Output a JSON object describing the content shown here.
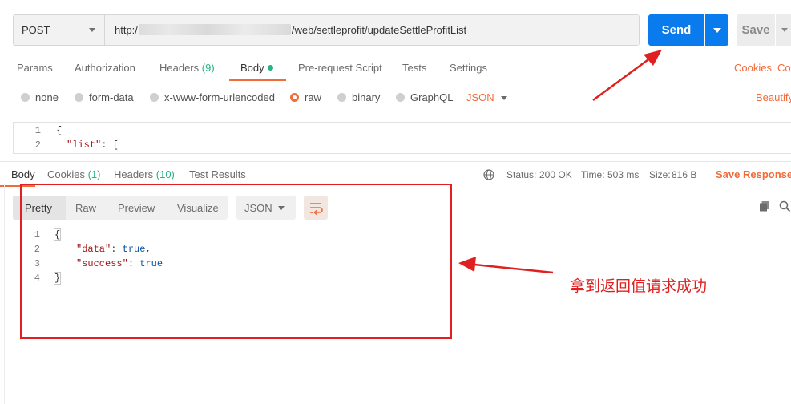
{
  "request": {
    "method": "POST",
    "url_prefix": "http:/",
    "url_suffix": "/web/settleprofit/updateSettleProfitList",
    "send_label": "Send",
    "save_label": "Save"
  },
  "request_tabs": {
    "params": "Params",
    "authorization": "Authorization",
    "headers": "Headers",
    "headers_count": "(9)",
    "body": "Body",
    "pre_request": "Pre-request Script",
    "tests": "Tests",
    "settings": "Settings",
    "cookies": "Cookies",
    "code": "Cod"
  },
  "body_types": {
    "none": "none",
    "form_data": "form-data",
    "urlencoded": "x-www-form-urlencoded",
    "raw": "raw",
    "binary": "binary",
    "graphql": "GraphQL",
    "format": "JSON",
    "beautify": "Beautify"
  },
  "request_editor": {
    "lines": [
      "1",
      "2"
    ],
    "line1": "{",
    "line2_key": "\"list\"",
    "line2_rest": ": ["
  },
  "response_tabs": {
    "body": "Body",
    "cookies": "Cookies",
    "cookies_count": "(1)",
    "headers": "Headers",
    "headers_count": "(10)",
    "test_results": "Test Results"
  },
  "response_status": {
    "status_label": "Status:",
    "status_value": "200 OK",
    "time_label": "Time:",
    "time_value": "503 ms",
    "size_label": "Size:",
    "size_value": "816 B",
    "save_response": "Save Response"
  },
  "response_view": {
    "pretty": "Pretty",
    "raw": "Raw",
    "preview": "Preview",
    "visualize": "Visualize",
    "format": "JSON"
  },
  "response_body": {
    "lines": [
      "1",
      "2",
      "3",
      "4"
    ],
    "open": "{",
    "data_key": "\"data\"",
    "data_val": "true",
    "success_key": "\"success\"",
    "success_val": "true",
    "close": "}"
  },
  "annotation": {
    "text": "拿到返回值请求成功",
    "color": "#e02020"
  },
  "colors": {
    "accent": "#f26b3a",
    "send": "#097bed",
    "success": "#26b47f"
  }
}
